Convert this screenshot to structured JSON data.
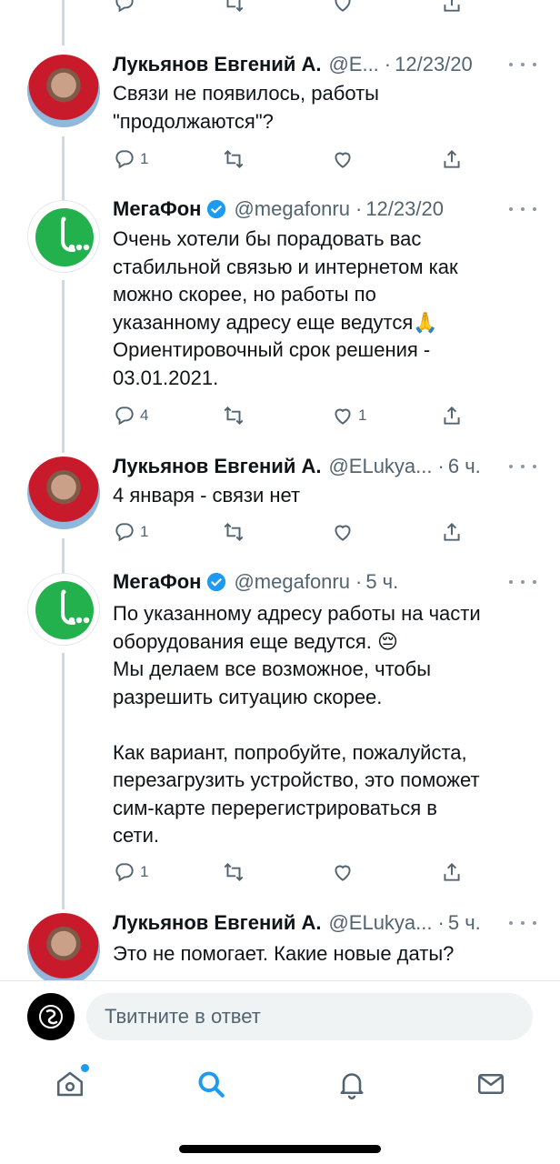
{
  "thread": {
    "tweets": [
      {
        "id": "t1",
        "name": "Лукьянов Евгений А.",
        "handle": "@E...",
        "time": "12/23/20",
        "text": "Связи не появилось, работы\n\"продолжаются\"?",
        "replies": "1",
        "retweets": "",
        "likes": "",
        "verified": false
      },
      {
        "id": "t2",
        "name": "МегаФон",
        "handle": "@megafonru",
        "time": "12/23/20",
        "text": "Очень хотели бы порадовать вас\nстабильной связью и интернетом как\nможно скорее, но работы по\nуказанному адресу еще ведутся🙏\nОриентировочный срок решения -\n03.01.2021.",
        "replies": "4",
        "retweets": "",
        "likes": "1",
        "verified": true
      },
      {
        "id": "t3",
        "name": "Лукьянов Евгений А.",
        "handle": "@ELukya...",
        "time": "6 ч.",
        "text": "4 января - связи нет",
        "replies": "1",
        "retweets": "",
        "likes": "",
        "verified": false
      },
      {
        "id": "t4",
        "name": "МегаФон",
        "handle": "@megafonru",
        "time": "5 ч.",
        "text": "По указанному адресу работы на части\nоборудования еще ведутся. 😔\nМы делаем все возможное, чтобы\nразрешить ситуацию скорее.\n\nКак вариант, попробуйте, пожалуйста,\nперезагрузить устройство, это поможет\nсим-карте перерегистрироваться в\nсети.",
        "replies": "1",
        "retweets": "",
        "likes": "",
        "verified": true
      },
      {
        "id": "t5",
        "name": "Лукьянов Евгений А.",
        "handle": "@ELukya...",
        "time": "5 ч.",
        "text": "Это не помогает. Какие новые даты?",
        "replies": "",
        "retweets": "",
        "likes": "",
        "verified": false
      }
    ]
  },
  "composer": {
    "placeholder": "Твитните в ответ"
  },
  "tabbar": {
    "items": [
      "home-icon",
      "search-icon",
      "notifications-icon",
      "messages-icon"
    ],
    "active": "search-icon",
    "home_has_new": true
  },
  "colors": {
    "accent": "#1d9bf0",
    "megafon_green": "#22b14c",
    "secondary_text": "#536471"
  }
}
